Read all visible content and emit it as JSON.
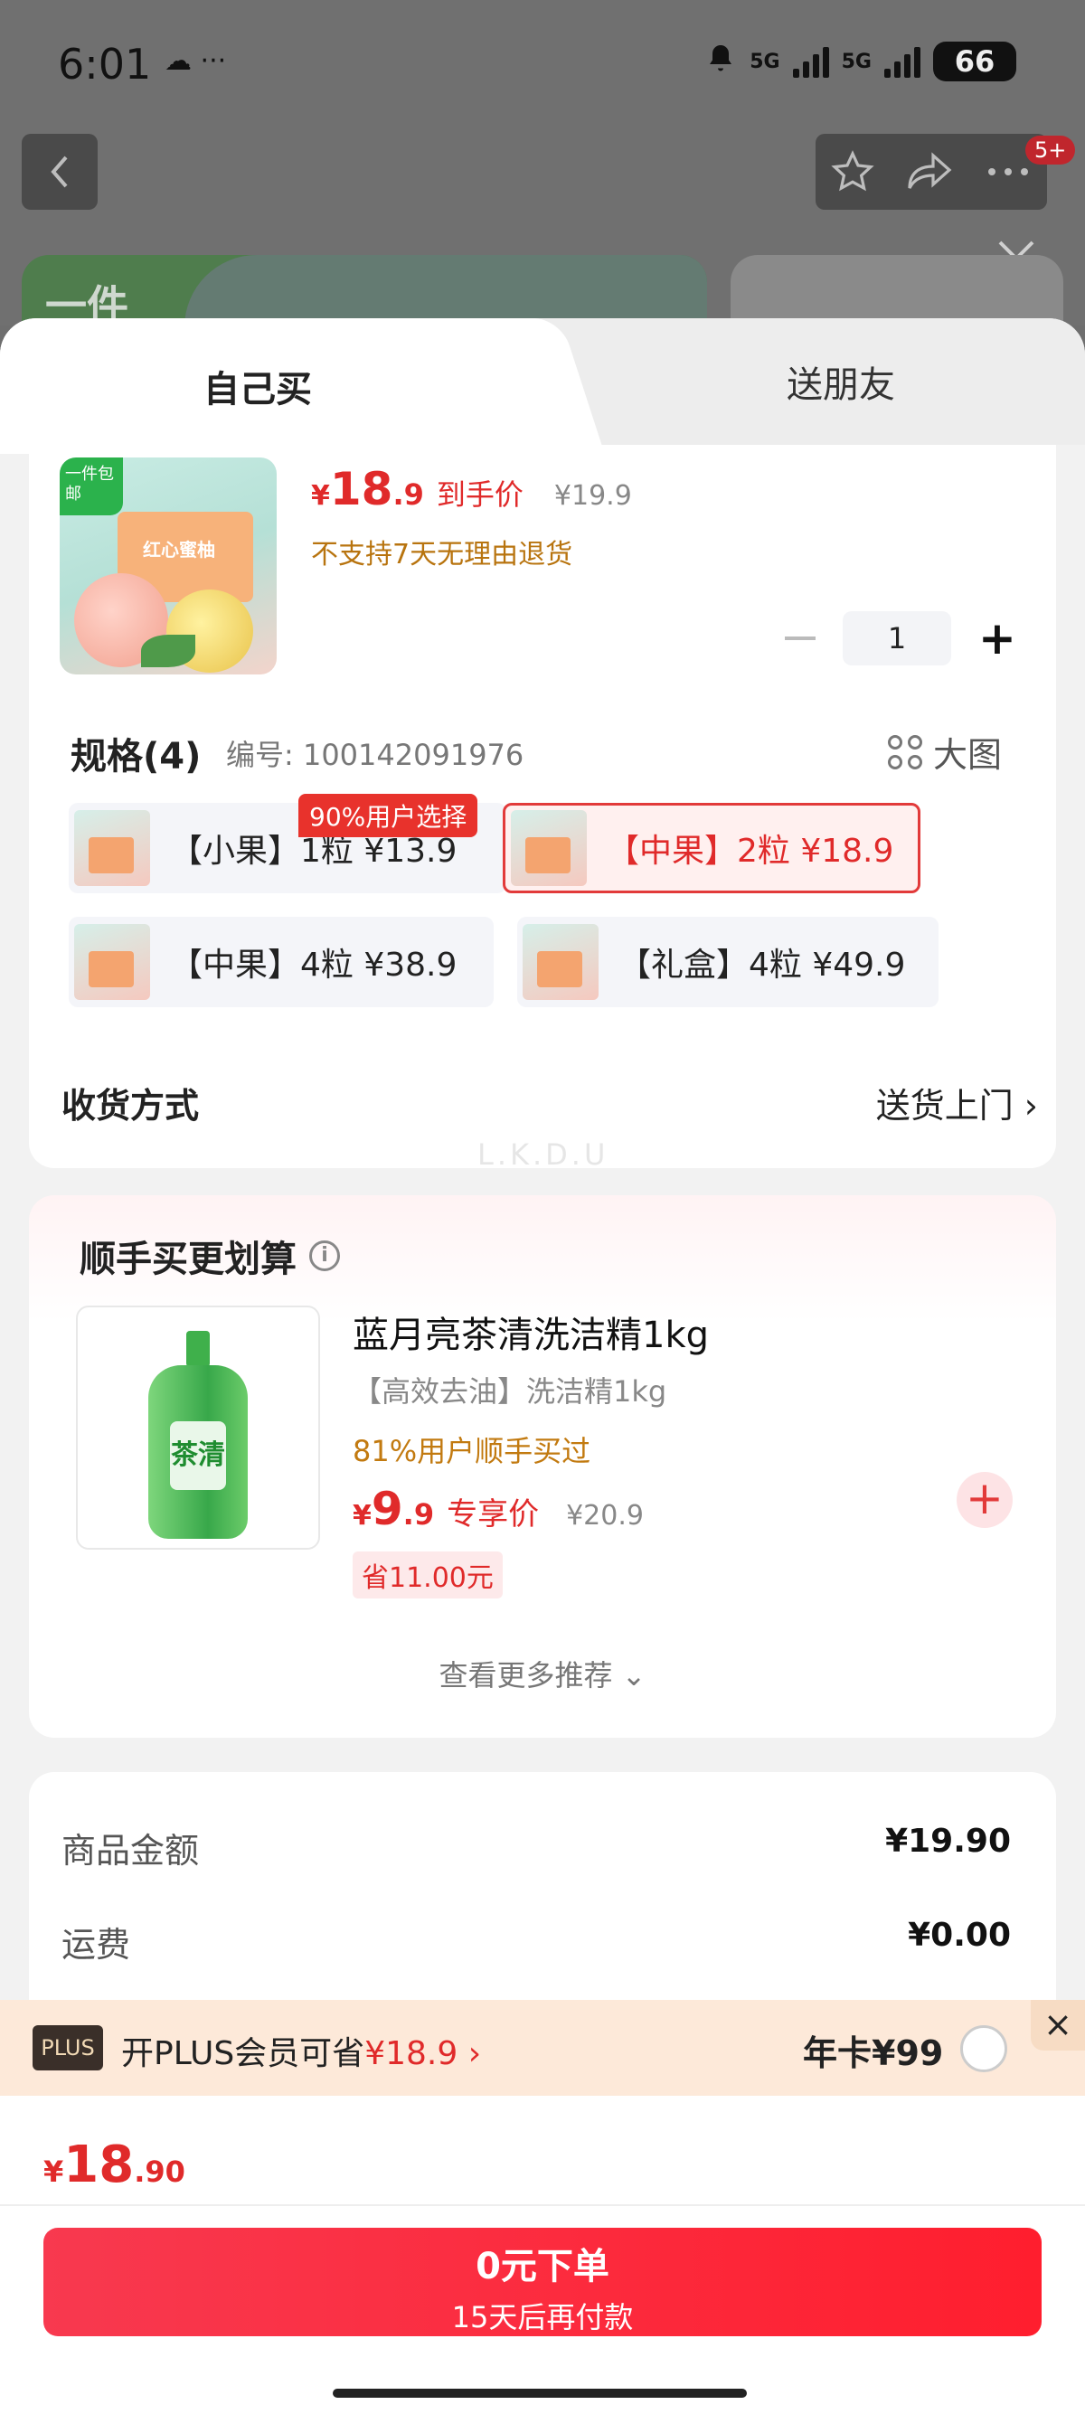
{
  "status_bar": {
    "time": "6:01",
    "misc": "☁ ···",
    "net1": "5G",
    "net2": "5G",
    "battery": "66"
  },
  "background": {
    "badge": "5+",
    "banner_text": "一件"
  },
  "tabs": {
    "self": "自己买",
    "friend": "送朋友"
  },
  "product": {
    "thumb_tag": "一件包邮",
    "thumb_box": "红心蜜柚",
    "price_symbol": "¥",
    "price_int": "18",
    "price_dec": ".9",
    "price_label": "到手价",
    "orig_price": "¥19.9",
    "return_note": "不支持7天无理由退货",
    "quantity": "1"
  },
  "spec": {
    "title": "规格(4)",
    "code": "编号: 100142091976",
    "big_image": "大图",
    "badge": "90%用户选择",
    "options": [
      {
        "label": "【小果】1粒  ¥13.9",
        "selected": false
      },
      {
        "label": "【中果】2粒  ¥18.9",
        "selected": true
      },
      {
        "label": "【中果】4粒  ¥38.9",
        "selected": false
      },
      {
        "label": "【礼盒】4粒  ¥49.9",
        "selected": false
      }
    ]
  },
  "delivery": {
    "label": "收货方式",
    "value": "送货上门 ›"
  },
  "watermark": "L.K.D.U",
  "recommend": {
    "title": "顺手买更划算",
    "item": {
      "name": "蓝月亮茶清洗洁精1kg",
      "sub": "【高效去油】洗洁精1kg",
      "bought": "81%用户顺手买过",
      "price_symbol": "¥",
      "price_int": "9",
      "price_dec": ".9",
      "price_label": "专享价",
      "orig_price": "¥20.9",
      "save": "省11.00元",
      "bottle_label": "茶清"
    },
    "more": "查看更多推荐 ⌄"
  },
  "summary": {
    "rows": [
      {
        "key": "商品金额",
        "value": "¥19.90"
      },
      {
        "key": "运费",
        "value": "¥0.00"
      }
    ]
  },
  "plus": {
    "logo": "PLUS",
    "text_prefix": "开PLUS会员可省",
    "amount": "¥18.9 ›",
    "year_card": "年卡¥99",
    "close": "×"
  },
  "footer": {
    "total_symbol": "¥",
    "total_int": "18",
    "total_dec": ".90",
    "button_main": "0元下单",
    "button_sub": "15天后再付款"
  },
  "colors": {
    "accent_red": "#e02a2a",
    "brand_green": "#2bb24c",
    "note_orange": "#b8740f"
  }
}
